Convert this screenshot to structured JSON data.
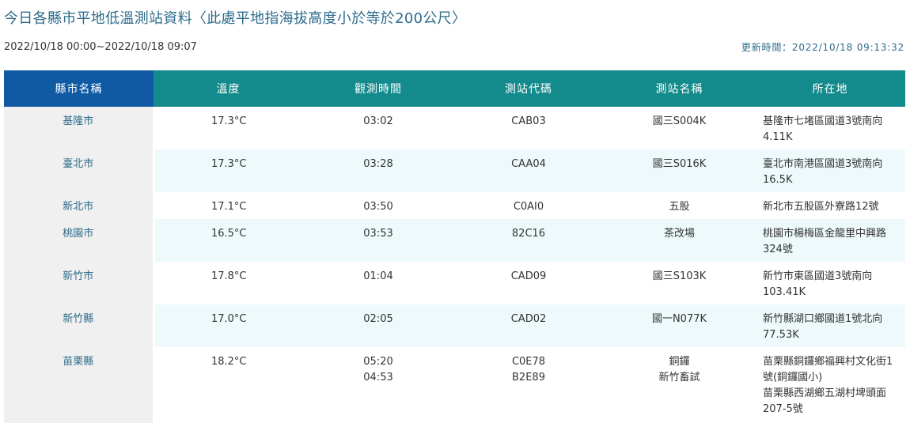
{
  "header": {
    "title": "今日各縣市平地低溫測站資料〈此處平地指海拔高度小於等於200公尺〉",
    "date_range": "2022/10/18 00:00~2022/10/18 09:07",
    "update_time": "更新時間：2022/10/18 09:13:32"
  },
  "table": {
    "headers": [
      "縣市名稱",
      "溫度",
      "觀測時間",
      "測站代碼",
      "測站名稱",
      "所在地"
    ],
    "rows": [
      {
        "county": "基隆市",
        "temp": "17.3°C",
        "time": [
          "03:02"
        ],
        "code": [
          "CAB03"
        ],
        "name": [
          "國三S004K"
        ],
        "location": [
          "基隆市七堵區國道3號南向4.11K"
        ]
      },
      {
        "county": "臺北市",
        "temp": "17.3°C",
        "time": [
          "03:28"
        ],
        "code": [
          "CAA04"
        ],
        "name": [
          "國三S016K"
        ],
        "location": [
          "臺北市南港區國道3號南向16.5K"
        ]
      },
      {
        "county": "新北市",
        "temp": "17.1°C",
        "time": [
          "03:50"
        ],
        "code": [
          "C0AI0"
        ],
        "name": [
          "五股"
        ],
        "location": [
          "新北市五股區外寮路12號"
        ]
      },
      {
        "county": "桃園市",
        "temp": "16.5°C",
        "time": [
          "03:53"
        ],
        "code": [
          "82C16"
        ],
        "name": [
          "茶改場"
        ],
        "location": [
          "桃園市楊梅區金龍里中興路324號"
        ]
      },
      {
        "county": "新竹市",
        "temp": "17.8°C",
        "time": [
          "01:04"
        ],
        "code": [
          "CAD09"
        ],
        "name": [
          "國三S103K"
        ],
        "location": [
          "新竹市東區國道3號南向103.41K"
        ]
      },
      {
        "county": "新竹縣",
        "temp": "17.0°C",
        "time": [
          "02:05"
        ],
        "code": [
          "CAD02"
        ],
        "name": [
          "國一N077K"
        ],
        "location": [
          "新竹縣湖口鄉國道1號北向77.53K"
        ]
      },
      {
        "county": "苗栗縣",
        "temp": "18.2°C",
        "time": [
          "05:20",
          "04:53"
        ],
        "code": [
          "C0E78",
          "B2E89"
        ],
        "name": [
          "銅鑼",
          "新竹畜試"
        ],
        "location": [
          "苗栗縣銅鑼鄉福興村文化街1號(銅鑼國小)",
          "苗栗縣西湖鄉五湖村埤頭面207-5號"
        ]
      }
    ]
  }
}
